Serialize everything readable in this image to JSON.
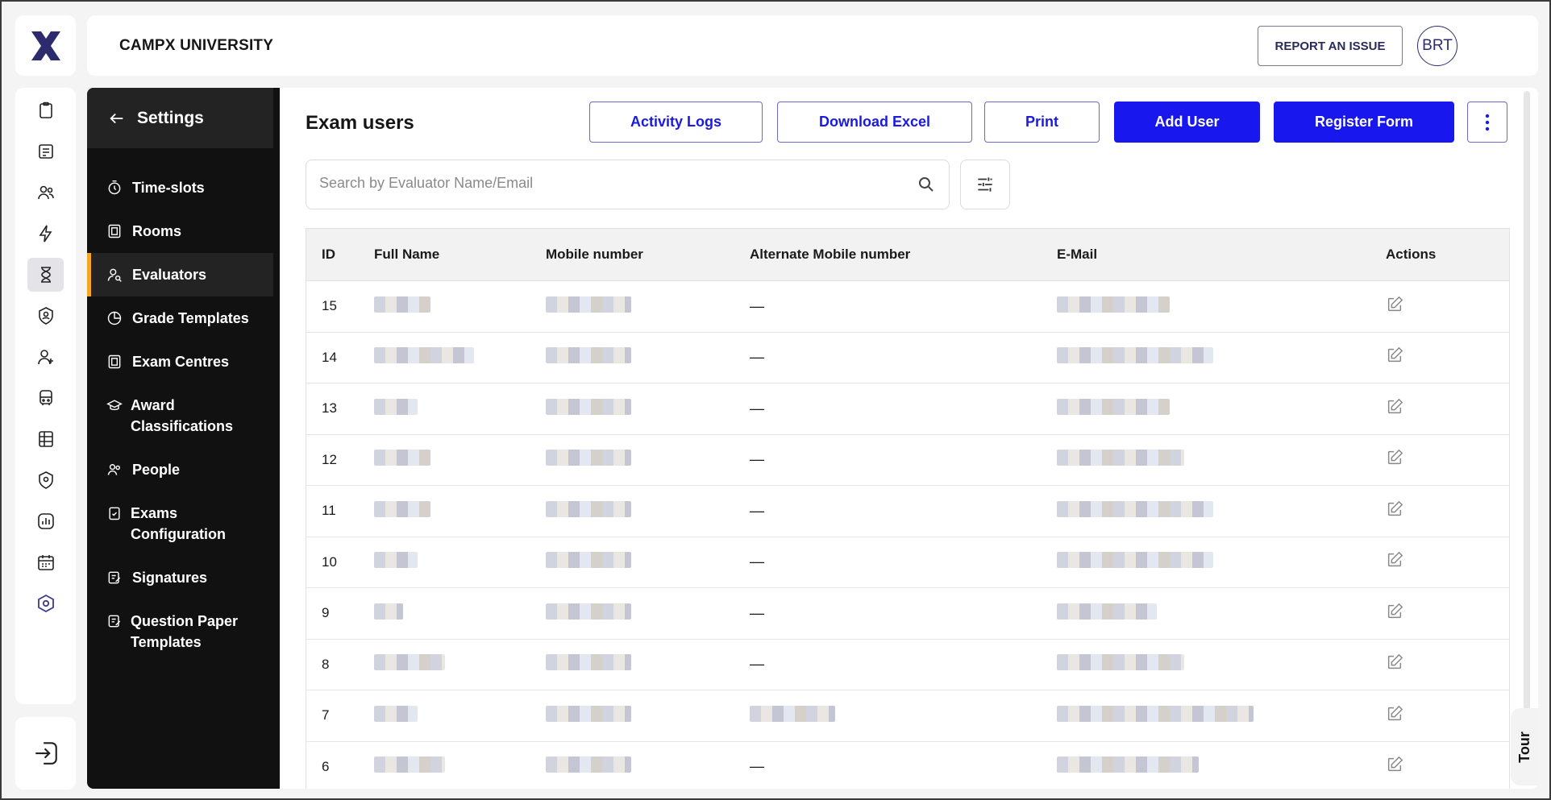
{
  "header": {
    "university": "CAMPX UNIVERSITY",
    "report_label": "REPORT AN ISSUE",
    "avatar": "BRT"
  },
  "rail": {
    "icons": [
      "clipboard-icon",
      "document-icon",
      "users-icon",
      "lightning-icon",
      "hourglass-icon",
      "shield-user-icon",
      "user-add-icon",
      "bus-icon",
      "table-icon",
      "shield-location-icon",
      "chart-icon",
      "calendar-icon",
      "settings-hex-icon"
    ],
    "active_index": 4
  },
  "settings": {
    "title": "Settings",
    "items": [
      {
        "label": "Time-slots",
        "icon": "stopwatch-icon"
      },
      {
        "label": "Rooms",
        "icon": "building-icon"
      },
      {
        "label": "Evaluators",
        "icon": "user-search-icon",
        "active": true
      },
      {
        "label": "Grade Templates",
        "icon": "chart-pie-icon"
      },
      {
        "label": "Exam Centres",
        "icon": "building-icon"
      },
      {
        "label": "Award Classifications",
        "icon": "graduation-cap-icon"
      },
      {
        "label": "People",
        "icon": "people-icon"
      },
      {
        "label": "Exams Configuration",
        "icon": "clipboard-check-icon"
      },
      {
        "label": "Signatures",
        "icon": "signature-icon"
      },
      {
        "label": "Question Paper Templates",
        "icon": "signature-icon"
      }
    ]
  },
  "main": {
    "title": "Exam users",
    "buttons": {
      "activity_logs": "Activity Logs",
      "download_excel": "Download Excel",
      "print": "Print",
      "add_user": "Add User",
      "register_form": "Register Form"
    },
    "search": {
      "placeholder": "Search by Evaluator Name/Email",
      "value": ""
    },
    "table": {
      "columns": [
        "ID",
        "Full Name",
        "Mobile number",
        "Alternate Mobile number",
        "E-Mail",
        "Actions"
      ],
      "rows": [
        {
          "id": "15",
          "alt": "—"
        },
        {
          "id": "14",
          "alt": "—"
        },
        {
          "id": "13",
          "alt": "—"
        },
        {
          "id": "12",
          "alt": "—"
        },
        {
          "id": "11",
          "alt": "—"
        },
        {
          "id": "10",
          "alt": "—"
        },
        {
          "id": "9",
          "alt": "—"
        },
        {
          "id": "8",
          "alt": "—"
        },
        {
          "id": "7",
          "alt": ""
        },
        {
          "id": "6",
          "alt": "—"
        }
      ]
    },
    "tour_label": "Tour"
  },
  "colors": {
    "primary": "#1717ee",
    "sidebar": "#111111",
    "active_accent": "#f5a623",
    "brand": "#2c2c6c"
  }
}
